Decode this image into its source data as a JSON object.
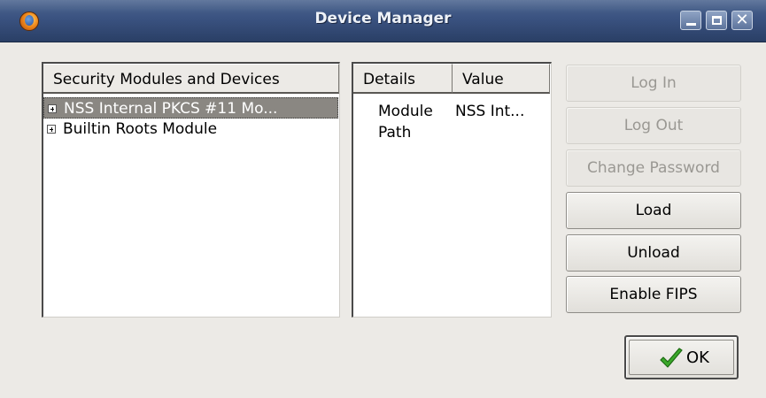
{
  "window": {
    "title": "Device Manager",
    "icon": "firefox-icon"
  },
  "titlebar_buttons": [
    {
      "name": "minimize-button",
      "icon": "minimize-icon"
    },
    {
      "name": "maximize-button",
      "icon": "maximize-icon"
    },
    {
      "name": "close-button",
      "icon": "close-icon",
      "glyph": "✕"
    }
  ],
  "modules_tree": {
    "header": "Security Modules and Devices",
    "items": [
      {
        "label": "NSS Internal PKCS #11 Mo...",
        "selected": true,
        "expander": "+"
      },
      {
        "label": "Builtin Roots Module",
        "selected": false,
        "expander": "+"
      }
    ]
  },
  "details_table": {
    "columns": [
      "Details",
      "Value"
    ],
    "rows": [
      {
        "detail": "Module",
        "value": "NSS Int..."
      },
      {
        "detail": "Path",
        "value": ""
      }
    ]
  },
  "buttons": {
    "log_in": {
      "label": "Log In",
      "enabled": false
    },
    "log_out": {
      "label": "Log Out",
      "enabled": false
    },
    "change_password": {
      "label": "Change Password",
      "enabled": false
    },
    "load": {
      "label": "Load",
      "enabled": true
    },
    "unload": {
      "label": "Unload",
      "enabled": true
    },
    "enable_fips": {
      "label": "Enable FIPS",
      "enabled": true
    }
  },
  "ok_button": {
    "label": "OK",
    "icon": "checkmark-icon"
  },
  "colors": {
    "titlebar": "#3a5280",
    "window_bg": "#eceae6",
    "selection": "#8a8782",
    "disabled_text": "#9a9893",
    "check_green": "#3aa82a"
  }
}
